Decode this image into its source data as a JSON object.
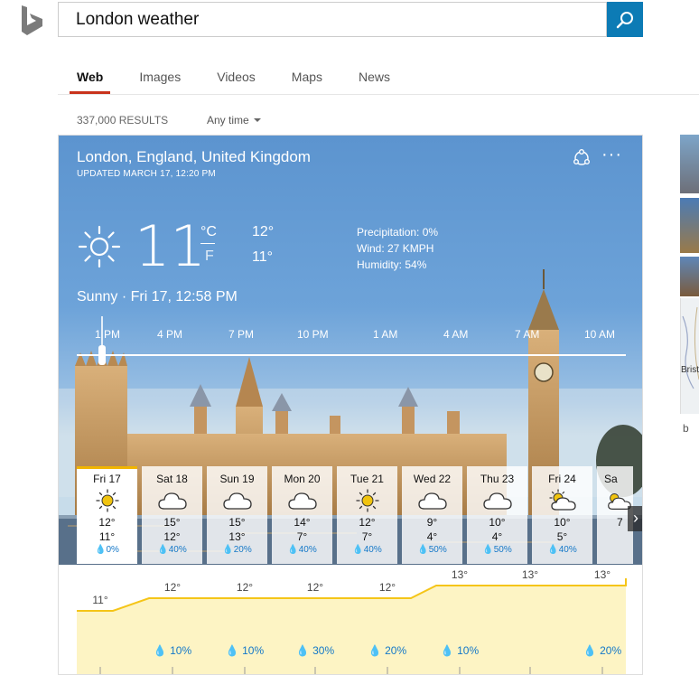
{
  "search": {
    "query": "London weather"
  },
  "nav": {
    "tabs": [
      "Web",
      "Images",
      "Videos",
      "Maps",
      "News"
    ]
  },
  "results": {
    "count": "337,000 RESULTS",
    "time_filter": "Any time"
  },
  "weather": {
    "location": "London, England, United Kingdom",
    "updated": "UPDATED MARCH 17, 12:20 PM",
    "temp": "11",
    "unit_c": "°C",
    "unit_f": "F",
    "high": "12°",
    "low": "11°",
    "precipitation": "Precipitation: 0%",
    "wind": "Wind: 27 KMPH",
    "humidity": "Humidity: 54%",
    "condition": "Sunny · Fri 17, 12:58 PM",
    "hours": [
      "1 PM",
      "4 PM",
      "7 PM",
      "10 PM",
      "1 AM",
      "4 AM",
      "7 AM",
      "10 AM"
    ],
    "days": [
      {
        "name": "Fri 17",
        "icon": "sunny-icon",
        "hi": "12°",
        "lo": "11°",
        "prec": "0%"
      },
      {
        "name": "Sat 18",
        "icon": "cloud-icon",
        "hi": "15°",
        "lo": "12°",
        "prec": "40%"
      },
      {
        "name": "Sun 19",
        "icon": "cloud-icon",
        "hi": "15°",
        "lo": "13°",
        "prec": "20%"
      },
      {
        "name": "Mon 20",
        "icon": "cloud-icon",
        "hi": "14°",
        "lo": "7°",
        "prec": "40%"
      },
      {
        "name": "Tue 21",
        "icon": "sunny-icon",
        "hi": "12°",
        "lo": "7°",
        "prec": "40%"
      },
      {
        "name": "Wed 22",
        "icon": "cloud-icon",
        "hi": "9°",
        "lo": "4°",
        "prec": "50%"
      },
      {
        "name": "Thu 23",
        "icon": "cloud-icon",
        "hi": "10°",
        "lo": "4°",
        "prec": "50%"
      },
      {
        "name": "Fri 24",
        "icon": "partly-sunny-icon",
        "hi": "10°",
        "lo": "5°",
        "prec": "40%"
      },
      {
        "name": "Sa",
        "icon": "partly-sunny-icon",
        "hi": "7",
        "lo": "",
        "prec": ""
      }
    ],
    "hourly_chart": {
      "temps": [
        "11°",
        "12°",
        "12°",
        "12°",
        "12°",
        "13°",
        "13°",
        "13°"
      ],
      "temp_values": [
        11,
        12,
        12,
        12,
        12,
        13,
        13,
        13
      ],
      "precip": [
        "",
        "10%",
        "10%",
        "30%",
        "20%",
        "10%",
        "",
        "20%"
      ]
    }
  },
  "sidebar": {
    "map_label": "Brist",
    "brand": "b"
  },
  "colors": {
    "accent": "#0c7bb5",
    "tab_underline": "#c8331c",
    "sun": "#f1c40f",
    "chart_fill": "#fdf4c4",
    "chart_line": "#f5c518",
    "precip": "#1478c8"
  }
}
